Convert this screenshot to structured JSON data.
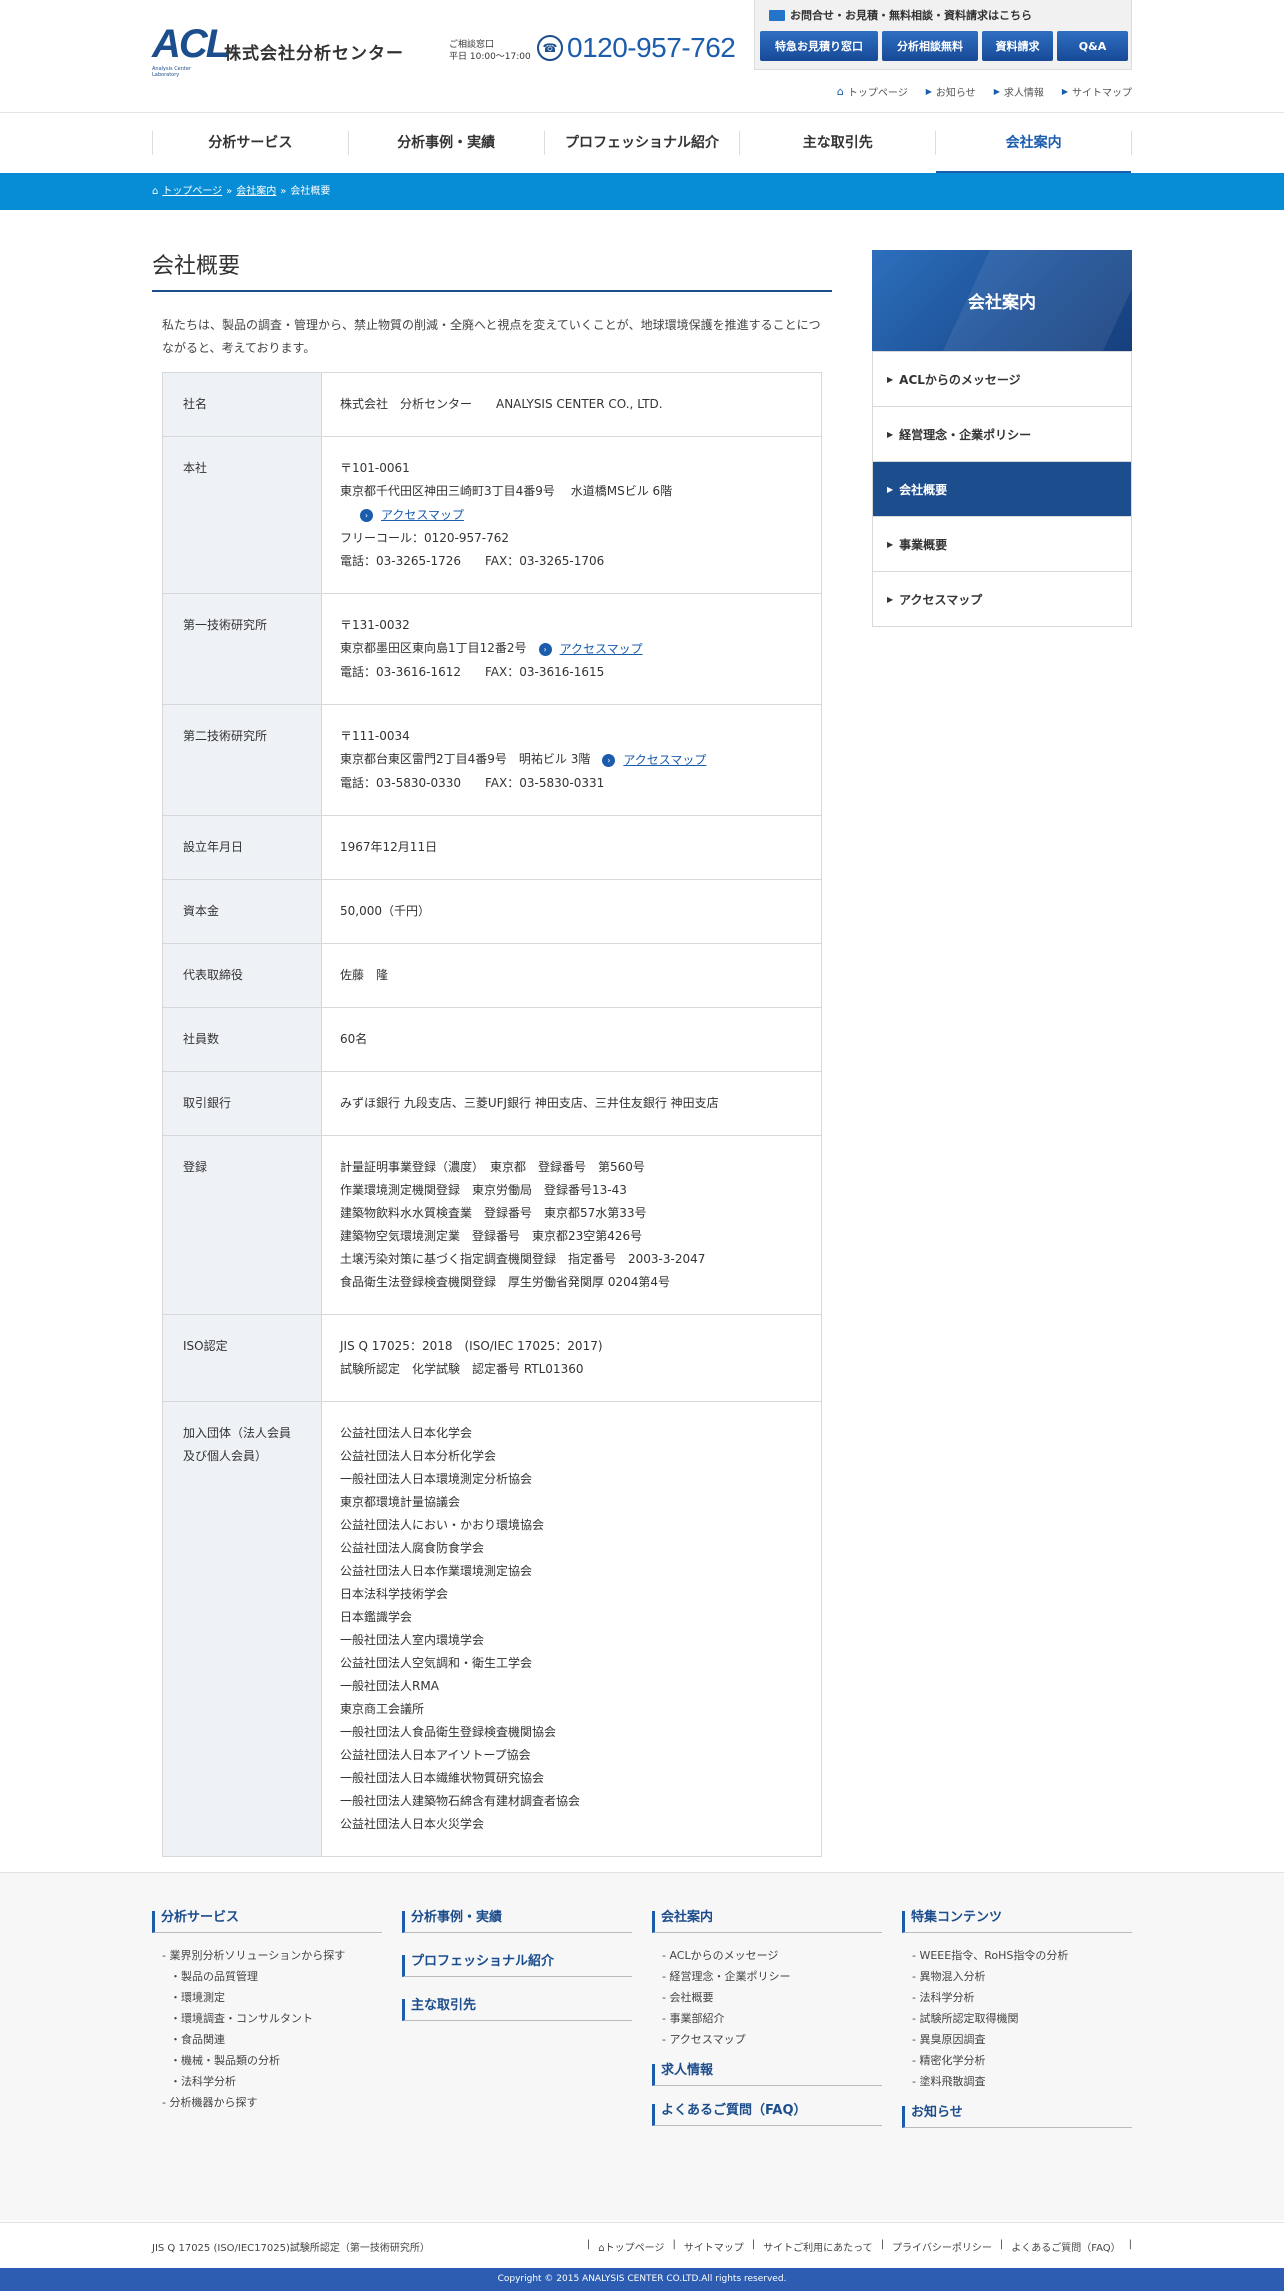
{
  "header": {
    "logo_text": "ACL",
    "logo_sub": "Analysis Center Laboratory",
    "company": "株式会社分析センター",
    "consult_label": "ご相談窓口",
    "consult_hours": "平日 10:00〜17:00",
    "phone": "0120-957-762",
    "contact_title": "お問合せ・お見積・無料相談・資料請求はこちら",
    "buttons": [
      "特急お見積り窓口",
      "分析相談無料",
      "資料請求",
      "Q&A"
    ],
    "toplinks": [
      "トップページ",
      "お知らせ",
      "求人情報",
      "サイトマップ"
    ]
  },
  "nav": [
    "分析サービス",
    "分析事例・実績",
    "プロフェッショナル紹介",
    "主な取引先",
    "会社案内"
  ],
  "breadcrumb": {
    "home": "トップページ",
    "parent": "会社案内",
    "current": "会社概要",
    "sep": "»"
  },
  "page": {
    "title": "会社概要",
    "lead": "私たちは、製品の調査・管理から、禁止物質の削減・全廃へと視点を変えていくことが、地球環境保護を推進することにつながると、考えております。"
  },
  "table": {
    "company_label": "社名",
    "company_value": "株式会社　分析センター　　ANALYSIS CENTER CO., LTD.",
    "hq_label": "本社",
    "hq_zip": "〒101-0061",
    "hq_address": "東京都千代田区神田三崎町3丁目4番9号　 水道橋MSビル 6階",
    "hq_tollfree": "フリーコール：0120-957-762",
    "hq_tel": "電話：03-3265-1726　　FAX：03-3265-1706",
    "lab1_label": "第一技術研究所",
    "lab1_zip": "〒131-0032",
    "lab1_address": "東京都墨田区東向島1丁目12番2号",
    "lab1_tel": "電話：03-3616-1612　　FAX：03-3616-1615",
    "lab2_label": "第二技術研究所",
    "lab2_zip": "〒111-0034",
    "lab2_address": "東京都台東区雷門2丁目4番9号　明祐ビル 3階",
    "lab2_tel": "電話：03-5830-0330　　FAX：03-5830-0331",
    "map_link": "アクセスマップ",
    "founded_label": "設立年月日",
    "founded_value": "1967年12月11日",
    "capital_label": "資本金",
    "capital_value": "50,000（千円）",
    "ceo_label": "代表取締役",
    "ceo_value": "佐藤　隆",
    "employees_label": "社員数",
    "employees_value": "60名",
    "bank_label": "取引銀行",
    "bank_value": "みずほ銀行 九段支店、三菱UFJ銀行 神田支店、三井住友銀行 神田支店",
    "reg_label": "登録",
    "registrations": [
      "計量証明事業登録（濃度）　東京都　登録番号　第560号",
      "作業環境測定機関登録　東京労働局　登録番号13-43",
      "建築物飲料水水質検査業　登録番号　東京都57水第33号",
      "建築物空気環境測定業　登録番号　東京都23空第426号",
      "土壌汚染対策に基づく指定調査機関登録　指定番号　2003-3-2047",
      "食品衛生法登録検査機関登録　厚生労働省発関厚 0204第4号"
    ],
    "iso_label": "ISO認定",
    "iso": [
      "JIS Q 17025：2018　(ISO/IEC 17025：2017)",
      "試験所認定　化学試験　認定番号 RTL01360"
    ],
    "member_label": "加入団体（法人会員及び個人会員）",
    "members": [
      "公益社団法人日本化学会",
      "公益社団法人日本分析化学会",
      "一般社団法人日本環境測定分析協会",
      "東京都環境計量協議会",
      "公益社団法人におい・かおり環境協会",
      "公益社団法人腐食防食学会",
      "公益社団法人日本作業環境測定協会",
      "日本法科学技術学会",
      "日本鑑識学会",
      "一般社団法人室内環境学会",
      "公益社団法人空気調和・衛生工学会",
      "一般社団法人RMA",
      "東京商工会議所",
      "一般社団法人食品衛生登録検査機関協会",
      "公益社団法人日本アイソトープ協会",
      "一般社団法人日本繊維状物質研究協会",
      "一般社団法人建築物石綿含有建材調査者協会",
      "公益社団法人日本火災学会"
    ]
  },
  "side": {
    "title": "会社案内",
    "items": [
      "ACLからのメッセージ",
      "経営理念・企業ポリシー",
      "会社概要",
      "事業概要",
      "アクセスマップ"
    ]
  },
  "footer": {
    "col1_title": "分析サービス",
    "col1_items": [
      "- 業界別分析ソリューションから探す",
      "・製品の品質管理",
      "・環境測定",
      "・環境調査・コンサルタント",
      "・食品関連",
      "・機械・製品類の分析",
      "・法科学分析",
      "- 分析機器から探す"
    ],
    "col2_titles": [
      "分析事例・実績",
      "プロフェッショナル紹介",
      "主な取引先"
    ],
    "col3_title": "会社案内",
    "col3_items": [
      "- ACLからのメッセージ",
      "- 経営理念・企業ポリシー",
      "- 会社概要",
      "- 事業部紹介",
      "- アクセスマップ"
    ],
    "col3_extra": [
      "求人情報",
      "よくあるご質問（FAQ）"
    ],
    "col4_title": "特集コンテンツ",
    "col4_items": [
      "- WEEE指令、RoHS指令の分析",
      "- 異物混入分析",
      "- 法科学分析",
      "- 試験所認定取得機関",
      "- 異臭原因調査",
      "- 精密化学分析",
      "- 塗料飛散調査"
    ],
    "col4_extra": "お知らせ",
    "iso_note": "JIS Q 17025 (ISO/IEC17025)試験所認定（第一技術研究所）",
    "links": [
      "トップページ",
      "サイトマップ",
      "サイトご利用にあたって",
      "プライバシーポリシー",
      "よくあるご質問（FAQ）"
    ],
    "copyright": "Copyright © 2015 ANALYSIS CENTER CO.LTD.All rights reserved."
  }
}
